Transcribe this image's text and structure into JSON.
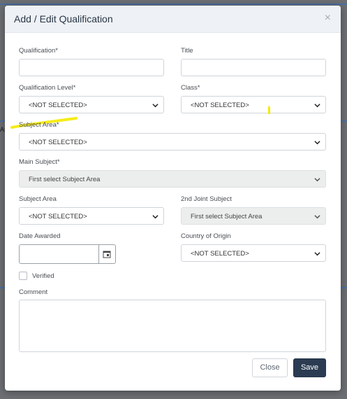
{
  "modal": {
    "title": "Add / Edit Qualification",
    "close_glyph": "×"
  },
  "form": {
    "qualification_label": "Qualification*",
    "qualification_value": "",
    "title_label": "Title",
    "title_value": "",
    "qualification_level_label": "Qualification Level*",
    "qualification_level_value": "<NOT SELECTED>",
    "class_label": "Class*",
    "class_value": "<NOT SELECTED>",
    "subject_area_label": "Subject Area*",
    "subject_area_value": "<NOT SELECTED>",
    "main_subject_label": "Main Subject*",
    "main_subject_value": "First select Subject Area",
    "subject_area2_label": "Subject Area",
    "subject_area2_value": "<NOT SELECTED>",
    "joint_subject_label": "2nd Joint Subject",
    "joint_subject_value": "First select Subject Area",
    "date_awarded_label": "Date Awarded",
    "date_awarded_value": "",
    "country_label": "Country of Origin",
    "country_value": "<NOT SELECTED>",
    "verified_label": "Verified",
    "verified_checked": false,
    "comment_label": "Comment",
    "comment_value": ""
  },
  "buttons": {
    "close_label": "Close",
    "save_label": "Save"
  },
  "colors": {
    "highlight": "#f5ea00",
    "save_button": "#2b3c52",
    "header_bg": "#eef1f5"
  },
  "background": {
    "fragment_text": "As"
  }
}
